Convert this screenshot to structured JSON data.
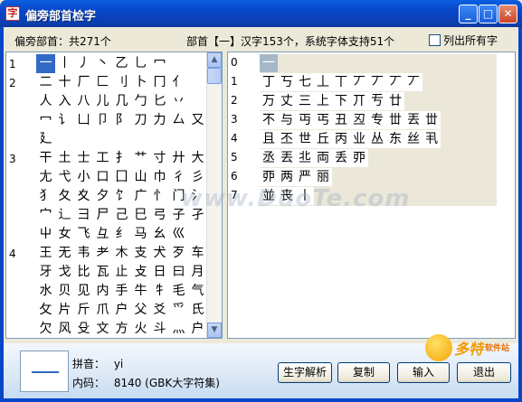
{
  "window": {
    "title": "偏旁部首检字",
    "app_icon_glyph": "字"
  },
  "header": {
    "radical_summary": "偏旁部首：共271个",
    "selection_summary": "部首【一】汉字153个，系统字体支持51个",
    "list_all_label": "列出所有字",
    "list_all_checked": false
  },
  "radicals": {
    "rows": [
      {
        "num": "1",
        "chars": [
          "一",
          "丨",
          "丿",
          "丶",
          "乙",
          "乚",
          "冖"
        ]
      },
      {
        "num": "2",
        "chars": [
          "二",
          "十",
          "厂",
          "匚",
          "刂",
          "卜",
          "冂",
          "亻"
        ]
      },
      {
        "num": "",
        "chars": [
          "人",
          "入",
          "八",
          "儿",
          "几",
          "勹",
          "匕",
          "丷"
        ]
      },
      {
        "num": "",
        "chars": [
          "冖",
          "讠",
          "凵",
          "卩",
          "阝",
          "刀",
          "力",
          "厶",
          "又"
        ]
      },
      {
        "num": "",
        "chars": [
          "廴"
        ]
      },
      {
        "num": "3",
        "chars": [
          "干",
          "土",
          "士",
          "工",
          "扌",
          "艹",
          "寸",
          "廾",
          "大"
        ]
      },
      {
        "num": "",
        "chars": [
          "尢",
          "弋",
          "小",
          "口",
          "囗",
          "山",
          "巾",
          "彳",
          "彡"
        ]
      },
      {
        "num": "",
        "chars": [
          "犭",
          "夂",
          "夊",
          "夕",
          "饣",
          "广",
          "忄",
          "门",
          "氵"
        ]
      },
      {
        "num": "",
        "chars": [
          "宀",
          "辶",
          "彐",
          "尸",
          "己",
          "巳",
          "弓",
          "子",
          "孑"
        ]
      },
      {
        "num": "",
        "chars": [
          "屮",
          "女",
          "飞",
          "彑",
          "纟",
          "马",
          "幺",
          "巛"
        ]
      },
      {
        "num": "4",
        "chars": [
          "王",
          "无",
          "韦",
          "耂",
          "木",
          "支",
          "犬",
          "歹",
          "车"
        ]
      },
      {
        "num": "",
        "chars": [
          "牙",
          "戈",
          "比",
          "瓦",
          "止",
          "攴",
          "日",
          "曰",
          "月"
        ]
      },
      {
        "num": "",
        "chars": [
          "水",
          "贝",
          "见",
          "内",
          "手",
          "牛",
          "牜",
          "毛",
          "气"
        ]
      },
      {
        "num": "",
        "chars": [
          "攵",
          "片",
          "斤",
          "爪",
          "户",
          "父",
          "爻",
          "爫",
          "氏"
        ]
      },
      {
        "num": "",
        "chars": [
          "欠",
          "风",
          "殳",
          "文",
          "方",
          "火",
          "斗",
          "灬",
          "户"
        ]
      }
    ]
  },
  "characters": {
    "rows": [
      {
        "num": "0",
        "chars": [
          "一"
        ]
      },
      {
        "num": "1",
        "chars": [
          "丁",
          "丂",
          "七",
          "丄",
          "丅",
          "丆",
          "丆",
          "丆",
          "丆"
        ]
      },
      {
        "num": "2",
        "chars": [
          "万",
          "丈",
          "三",
          "上",
          "下",
          "丌",
          "亐",
          "廿"
        ]
      },
      {
        "num": "3",
        "chars": [
          "不",
          "与",
          "丏",
          "丐",
          "丑",
          "丒",
          "专",
          "丗",
          "丟",
          "丗"
        ]
      },
      {
        "num": "4",
        "chars": [
          "且",
          "丕",
          "世",
          "丘",
          "丙",
          "业",
          "丛",
          "东",
          "丝",
          "丮"
        ]
      },
      {
        "num": "5",
        "chars": [
          "丞",
          "丟",
          "丠",
          "両",
          "丢",
          "丣"
        ]
      },
      {
        "num": "6",
        "chars": [
          "丣",
          "两",
          "严",
          "丽"
        ]
      },
      {
        "num": "7",
        "chars": [
          "並",
          "丧",
          "丨"
        ]
      }
    ]
  },
  "detail": {
    "pinyin_label": "拼音：",
    "pinyin_value": "yi",
    "code_label": "内码：",
    "code_value": "8140 (GBK大字符集)"
  },
  "buttons": {
    "parse": "生字解析",
    "copy": "复制",
    "input": "输入",
    "exit": "退出"
  },
  "watermark": "www.DuoTe.com",
  "logo": {
    "text": "多特",
    "sub": "软件站"
  },
  "colors": {
    "titlebar": "#0846c8",
    "selection": "#3169c6",
    "row_band": "#ebe8da",
    "window_bg": "#ece9d8"
  }
}
